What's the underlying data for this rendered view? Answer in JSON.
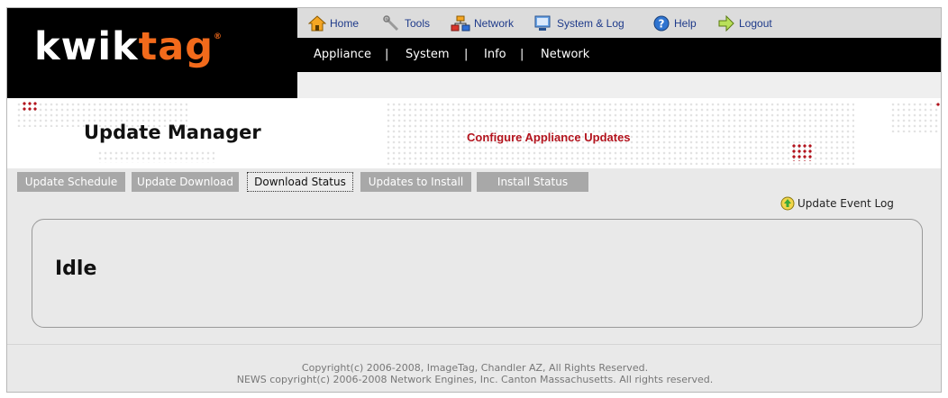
{
  "brand": {
    "logo_part1": "kwik",
    "logo_part2": "tag",
    "logo_mark": "®"
  },
  "topnav": [
    {
      "label": "Home",
      "icon": "home-icon"
    },
    {
      "label": "Tools",
      "icon": "tools-icon"
    },
    {
      "label": "Network",
      "icon": "network-icon"
    },
    {
      "label": "System & Log",
      "icon": "system-log-icon"
    },
    {
      "label": "Help",
      "icon": "help-icon"
    },
    {
      "label": "Logout",
      "icon": "logout-icon"
    }
  ],
  "subnav": [
    {
      "label": "Appliance"
    },
    {
      "label": "System"
    },
    {
      "label": "Info"
    },
    {
      "label": "Network"
    }
  ],
  "subnav_separator": "|",
  "page": {
    "title": "Update Manager",
    "subtitle": "Configure Appliance Updates"
  },
  "tabs": [
    {
      "label": "Update Schedule",
      "active": false
    },
    {
      "label": "Update Download",
      "active": false
    },
    {
      "label": "Download Status",
      "active": true
    },
    {
      "label": "Updates to Install",
      "active": false
    },
    {
      "label": "Install Status",
      "active": false
    }
  ],
  "event_log_link": "Update Event Log",
  "status": {
    "text": "Idle"
  },
  "footer": {
    "line1": "Copyright(c) 2006-2008, ImageTag, Chandler AZ, All Rights Reserved.",
    "line2": "NEWS copyright(c) 2006-2008 Network Engines, Inc. Canton Massachusetts.  All rights reserved."
  },
  "colors": {
    "accent_red": "#b3131d",
    "logo_orange": "#f26a1b",
    "tab_gray": "#a8a8a8"
  }
}
